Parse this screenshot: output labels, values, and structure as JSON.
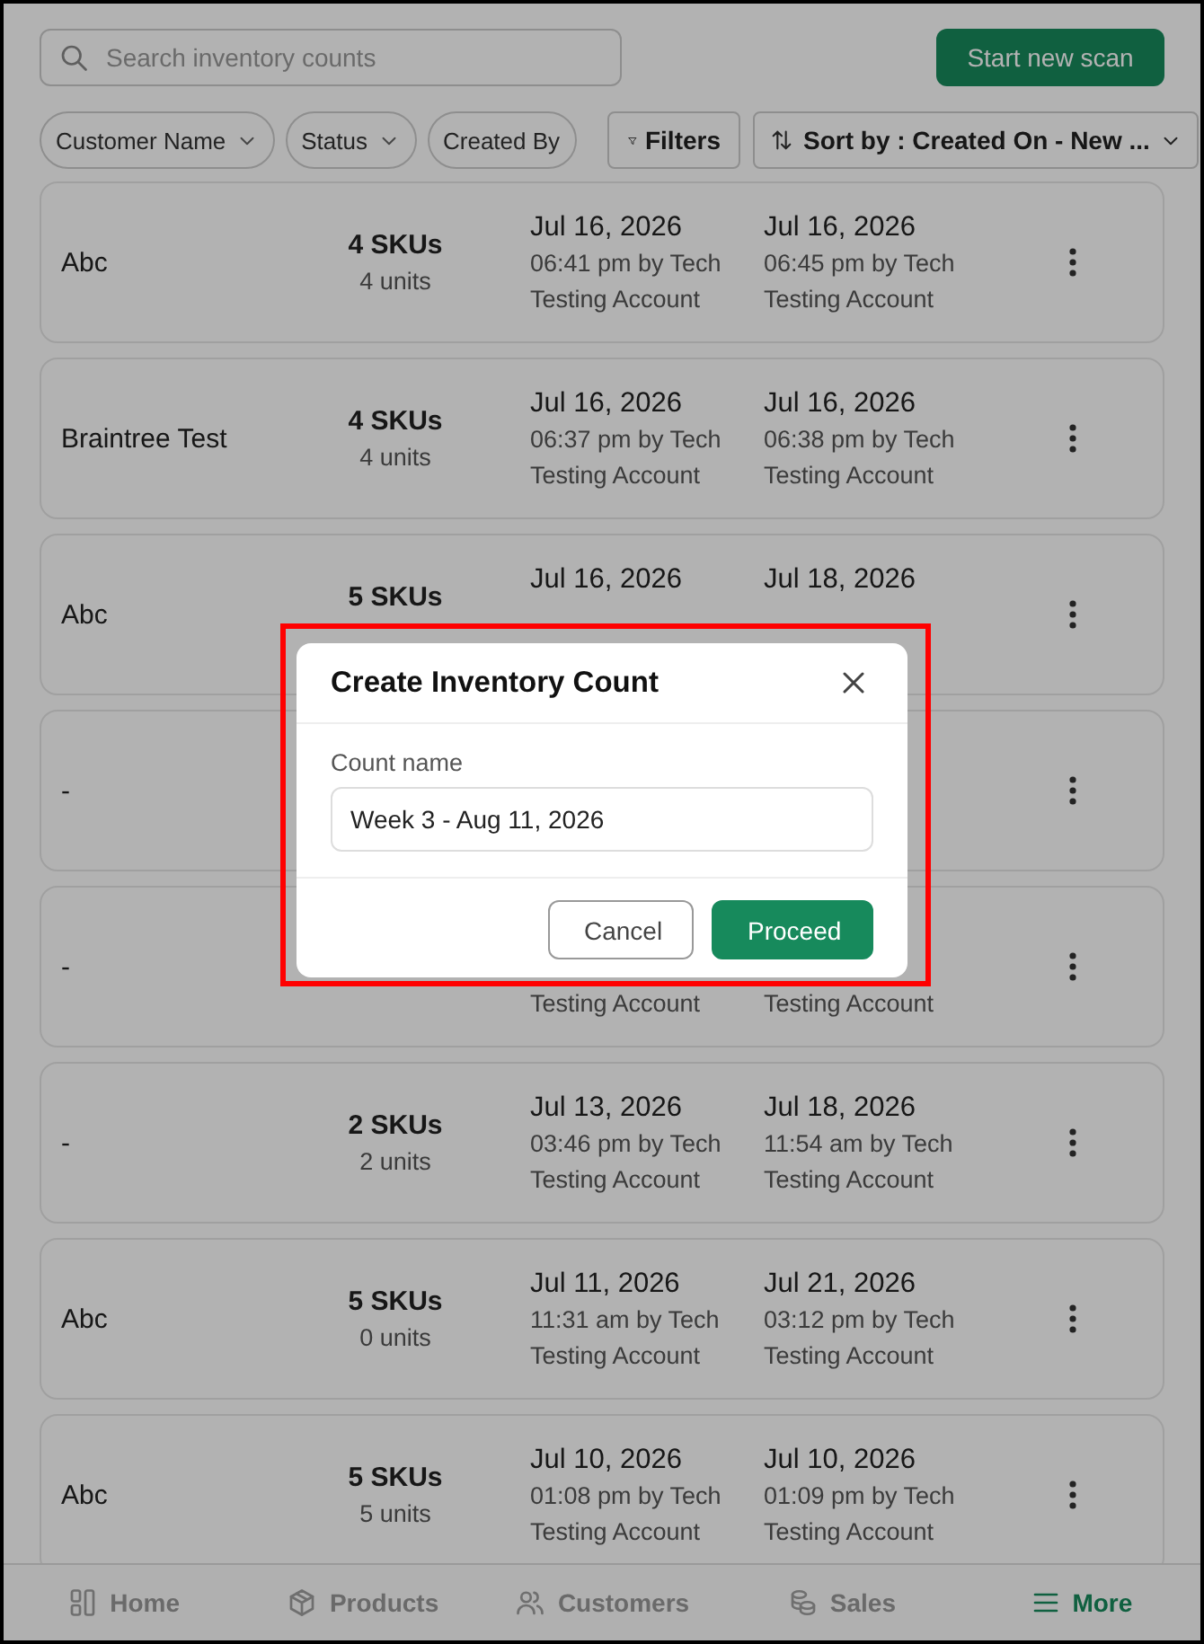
{
  "search": {
    "placeholder": "Search inventory counts"
  },
  "start_button": "Start new scan",
  "filter_chips": [
    {
      "label": "Customer Name",
      "caret": true
    },
    {
      "label": "Status",
      "caret": true
    },
    {
      "label": "Created By",
      "caret": false
    }
  ],
  "filters_button": "Filters",
  "sort_button": "Sort by : Created On - New ...",
  "rows": [
    {
      "name": "Abc",
      "skus": "4 SKUs",
      "units": "4 units",
      "created": {
        "date": "Jul 16, 2026",
        "time": "06:41 pm by Tech",
        "by": "Testing Account"
      },
      "updated": {
        "date": "Jul 16, 2026",
        "time": "06:45 pm by Tech",
        "by": "Testing Account"
      }
    },
    {
      "name": "Braintree Test",
      "skus": "4 SKUs",
      "units": "4 units",
      "created": {
        "date": "Jul 16, 2026",
        "time": "06:37 pm by Tech",
        "by": "Testing Account"
      },
      "updated": {
        "date": "Jul 16, 2026",
        "time": "06:38 pm by Tech",
        "by": "Testing Account"
      }
    },
    {
      "name": "Abc",
      "skus": "5 SKUs",
      "created": {
        "date": "Jul 16, 2026"
      },
      "updated": {
        "date": "Jul 18, 2026"
      }
    },
    {
      "name": "-"
    },
    {
      "name": "-",
      "created": {
        "by": "Testing Account"
      },
      "updated": {
        "by": "Testing Account"
      }
    },
    {
      "name": "-",
      "skus": "2 SKUs",
      "units": "2 units",
      "created": {
        "date": "Jul 13, 2026",
        "time": "03:46 pm by Tech",
        "by": "Testing Account"
      },
      "updated": {
        "date": "Jul 18, 2026",
        "time": "11:54 am by Tech",
        "by": "Testing Account"
      }
    },
    {
      "name": "Abc",
      "skus": "5 SKUs",
      "units": "0 units",
      "created": {
        "date": "Jul 11, 2026",
        "time": "11:31 am by Tech",
        "by": "Testing Account"
      },
      "updated": {
        "date": "Jul 21, 2026",
        "time": "03:12 pm by Tech",
        "by": "Testing Account"
      }
    },
    {
      "name": "Abc",
      "skus": "5 SKUs",
      "units": "5 units",
      "created": {
        "date": "Jul 10, 2026",
        "time": "01:08 pm by Tech",
        "by": "Testing Account"
      },
      "updated": {
        "date": "Jul 10, 2026",
        "time": "01:09 pm by Tech",
        "by": "Testing Account"
      }
    }
  ],
  "nav": [
    {
      "label": "Home",
      "kind": "home",
      "selected": false
    },
    {
      "label": "Products",
      "kind": "products",
      "selected": false
    },
    {
      "label": "Customers",
      "kind": "customers",
      "selected": false
    },
    {
      "label": "Sales",
      "kind": "sales",
      "selected": false
    },
    {
      "label": "More",
      "kind": "more",
      "selected": true
    }
  ],
  "dialog": {
    "title": "Create Inventory Count",
    "field_label": "Count name",
    "field_value": "Week 3 - Aug 11, 2026",
    "buttons": [
      {
        "label": "Cancel",
        "kind": "secondary"
      },
      {
        "label": "Proceed",
        "kind": "primary"
      }
    ]
  },
  "annotation": {
    "kind": "highlight"
  }
}
